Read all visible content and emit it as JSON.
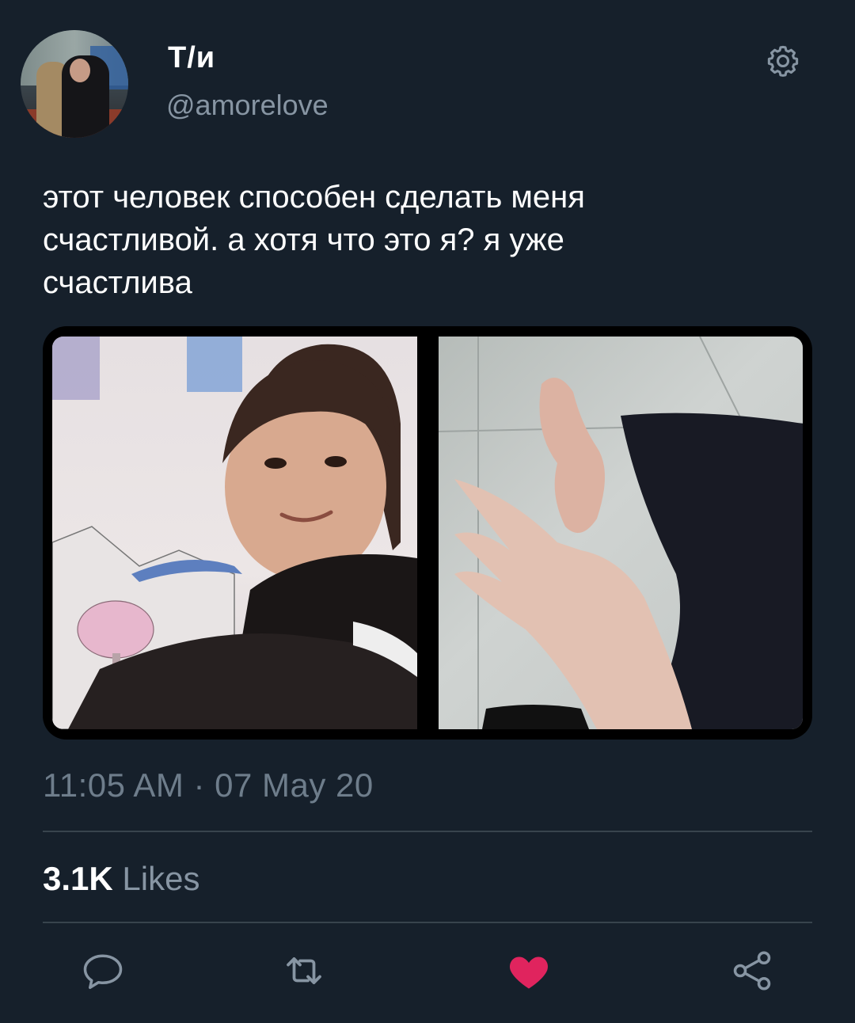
{
  "profile": {
    "display_name": "Т/и",
    "handle": "@amorelove",
    "avatar_icon": "profile-photo"
  },
  "tweet": {
    "text": "этот человек способен сделать меня\nсчастливой. а хотя что это я? я уже\nсчастлива",
    "timestamp": "11:05 AM · 07 May 20"
  },
  "stats": {
    "likes_count": "3.1K",
    "likes_label": "Likes"
  },
  "actions": {
    "reply_icon": "speech-bubble-icon",
    "retweet_icon": "retweet-icon",
    "like_icon": "heart-icon",
    "share_icon": "share-icon",
    "like_color": "#e0245e",
    "icon_color": "#8795a3"
  },
  "colors": {
    "background": "#16202b",
    "secondary_text": "#8795a3",
    "divider": "#38444d"
  }
}
